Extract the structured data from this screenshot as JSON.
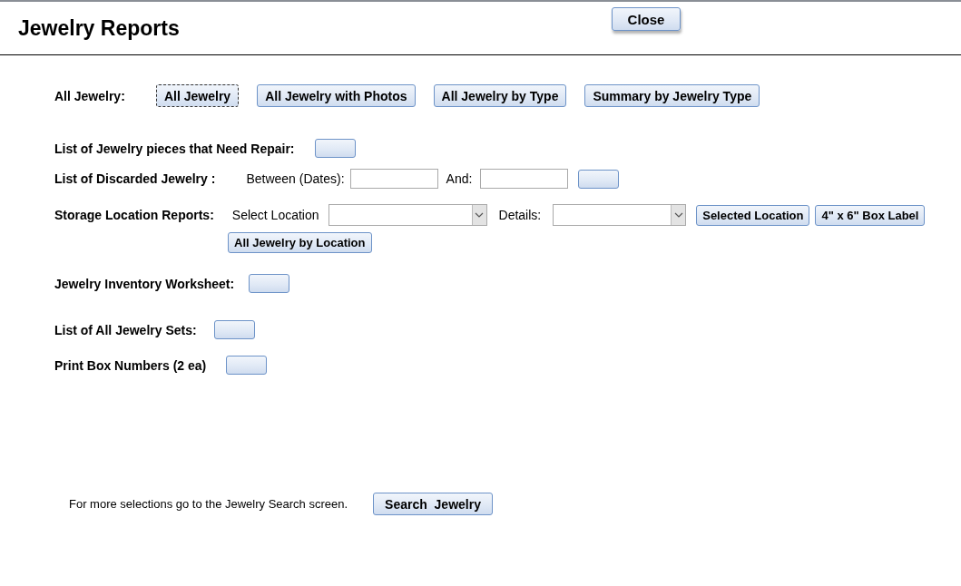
{
  "header": {
    "title": "Jewelry Reports",
    "close_button": "Close"
  },
  "all_jewelry": {
    "label": "All Jewelry:",
    "buttons": [
      {
        "label": "All Jewelry",
        "focused": true
      },
      {
        "label": "All Jewelry with Photos",
        "focused": false
      },
      {
        "label": "All Jewelry by Type",
        "focused": false
      },
      {
        "label": "Summary by Jewelry Type",
        "focused": false
      }
    ]
  },
  "repair": {
    "label": "List of Jewelry pieces that Need Repair:"
  },
  "discarded": {
    "label": "List of Discarded Jewelry :",
    "between_label": "Between (Dates):",
    "and_label": "And:"
  },
  "storage": {
    "label": "Storage Location Reports:",
    "select_label": "Select Location",
    "details_label": "Details:",
    "buttons": [
      "Selected Location",
      "4\" x 6\" Box Label"
    ],
    "location_button": "All Jewelry by Location"
  },
  "worksheet": {
    "label": "Jewelry Inventory Worksheet:"
  },
  "sets": {
    "label": "List of All Jewelry Sets:"
  },
  "box_numbers": {
    "label": "Print Box Numbers (2 ea)"
  },
  "footer": {
    "note": "For more selections go to the Jewelry Search screen.",
    "search_button": "Search  Jewelry"
  }
}
